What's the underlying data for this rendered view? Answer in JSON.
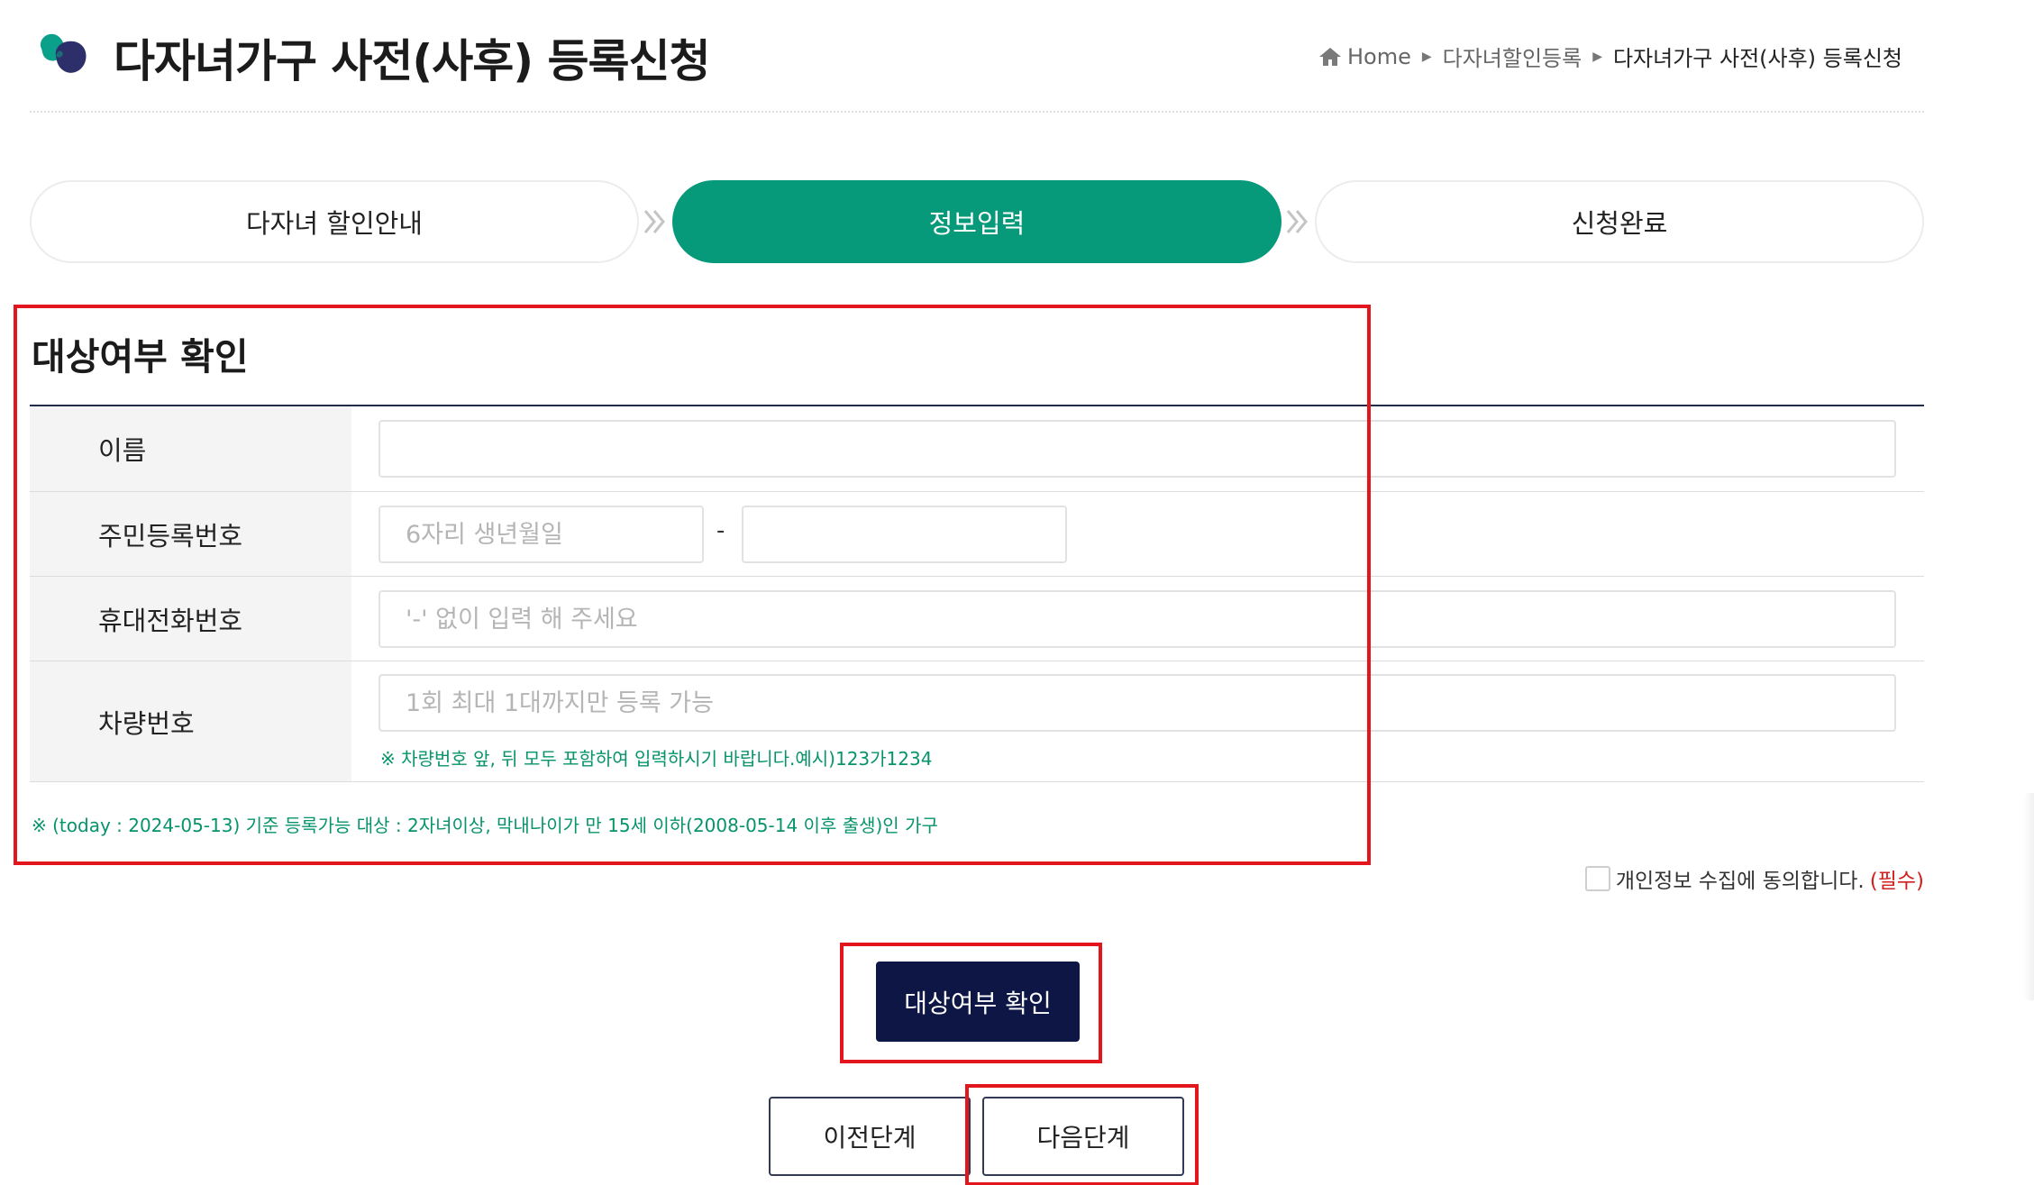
{
  "header": {
    "title": "다자녀가구 사전(사후) 등록신청",
    "breadcrumb": {
      "home": "Home",
      "middle": "다자녀할인등록",
      "current": "다자녀가구 사전(사후) 등록신청"
    }
  },
  "steps": [
    {
      "label": "다자녀 할인안내",
      "active": false
    },
    {
      "label": "정보입력",
      "active": true
    },
    {
      "label": "신청완료",
      "active": false
    }
  ],
  "form": {
    "section_title": "대상여부 확인",
    "name": {
      "label": "이름",
      "value": "",
      "placeholder": ""
    },
    "rrn": {
      "label": "주민등록번호",
      "front_placeholder": "6자리 생년월일",
      "separator": "-",
      "back_placeholder": ""
    },
    "phone": {
      "label": "휴대전화번호",
      "placeholder": "'-' 없이 입력 해 주세요"
    },
    "car": {
      "label": "차량번호",
      "placeholder": "1회 최대 1대까지만 등록 가능",
      "note": "※ 차량번호 앞, 뒤 모두 포함하여 입력하시기 바랍니다.예시)123가1234"
    },
    "eligibility_note": "※ (today : 2024-05-13) 기준 등록가능 대상 : 2자녀이상, 막내나이가 만 15세 이하(2008-05-14 이후 출생)인 가구"
  },
  "consent": {
    "label": "개인정보 수집에 동의합니다.",
    "required": "(필수)",
    "checked": false
  },
  "buttons": {
    "check": "대상여부 확인",
    "prev": "이전단계",
    "next": "다음단계"
  },
  "colors": {
    "accent_green": "#06997a",
    "navy": "#0d1645",
    "note_green": "#07936b",
    "highlight_red": "#e3161e",
    "required_red": "#d21f1f"
  },
  "icons": {
    "logo": "brand-logo",
    "home": "home-icon",
    "step_arrow": "double-chevron-right-icon",
    "breadcrumb_separator": "triangle-right-icon"
  }
}
